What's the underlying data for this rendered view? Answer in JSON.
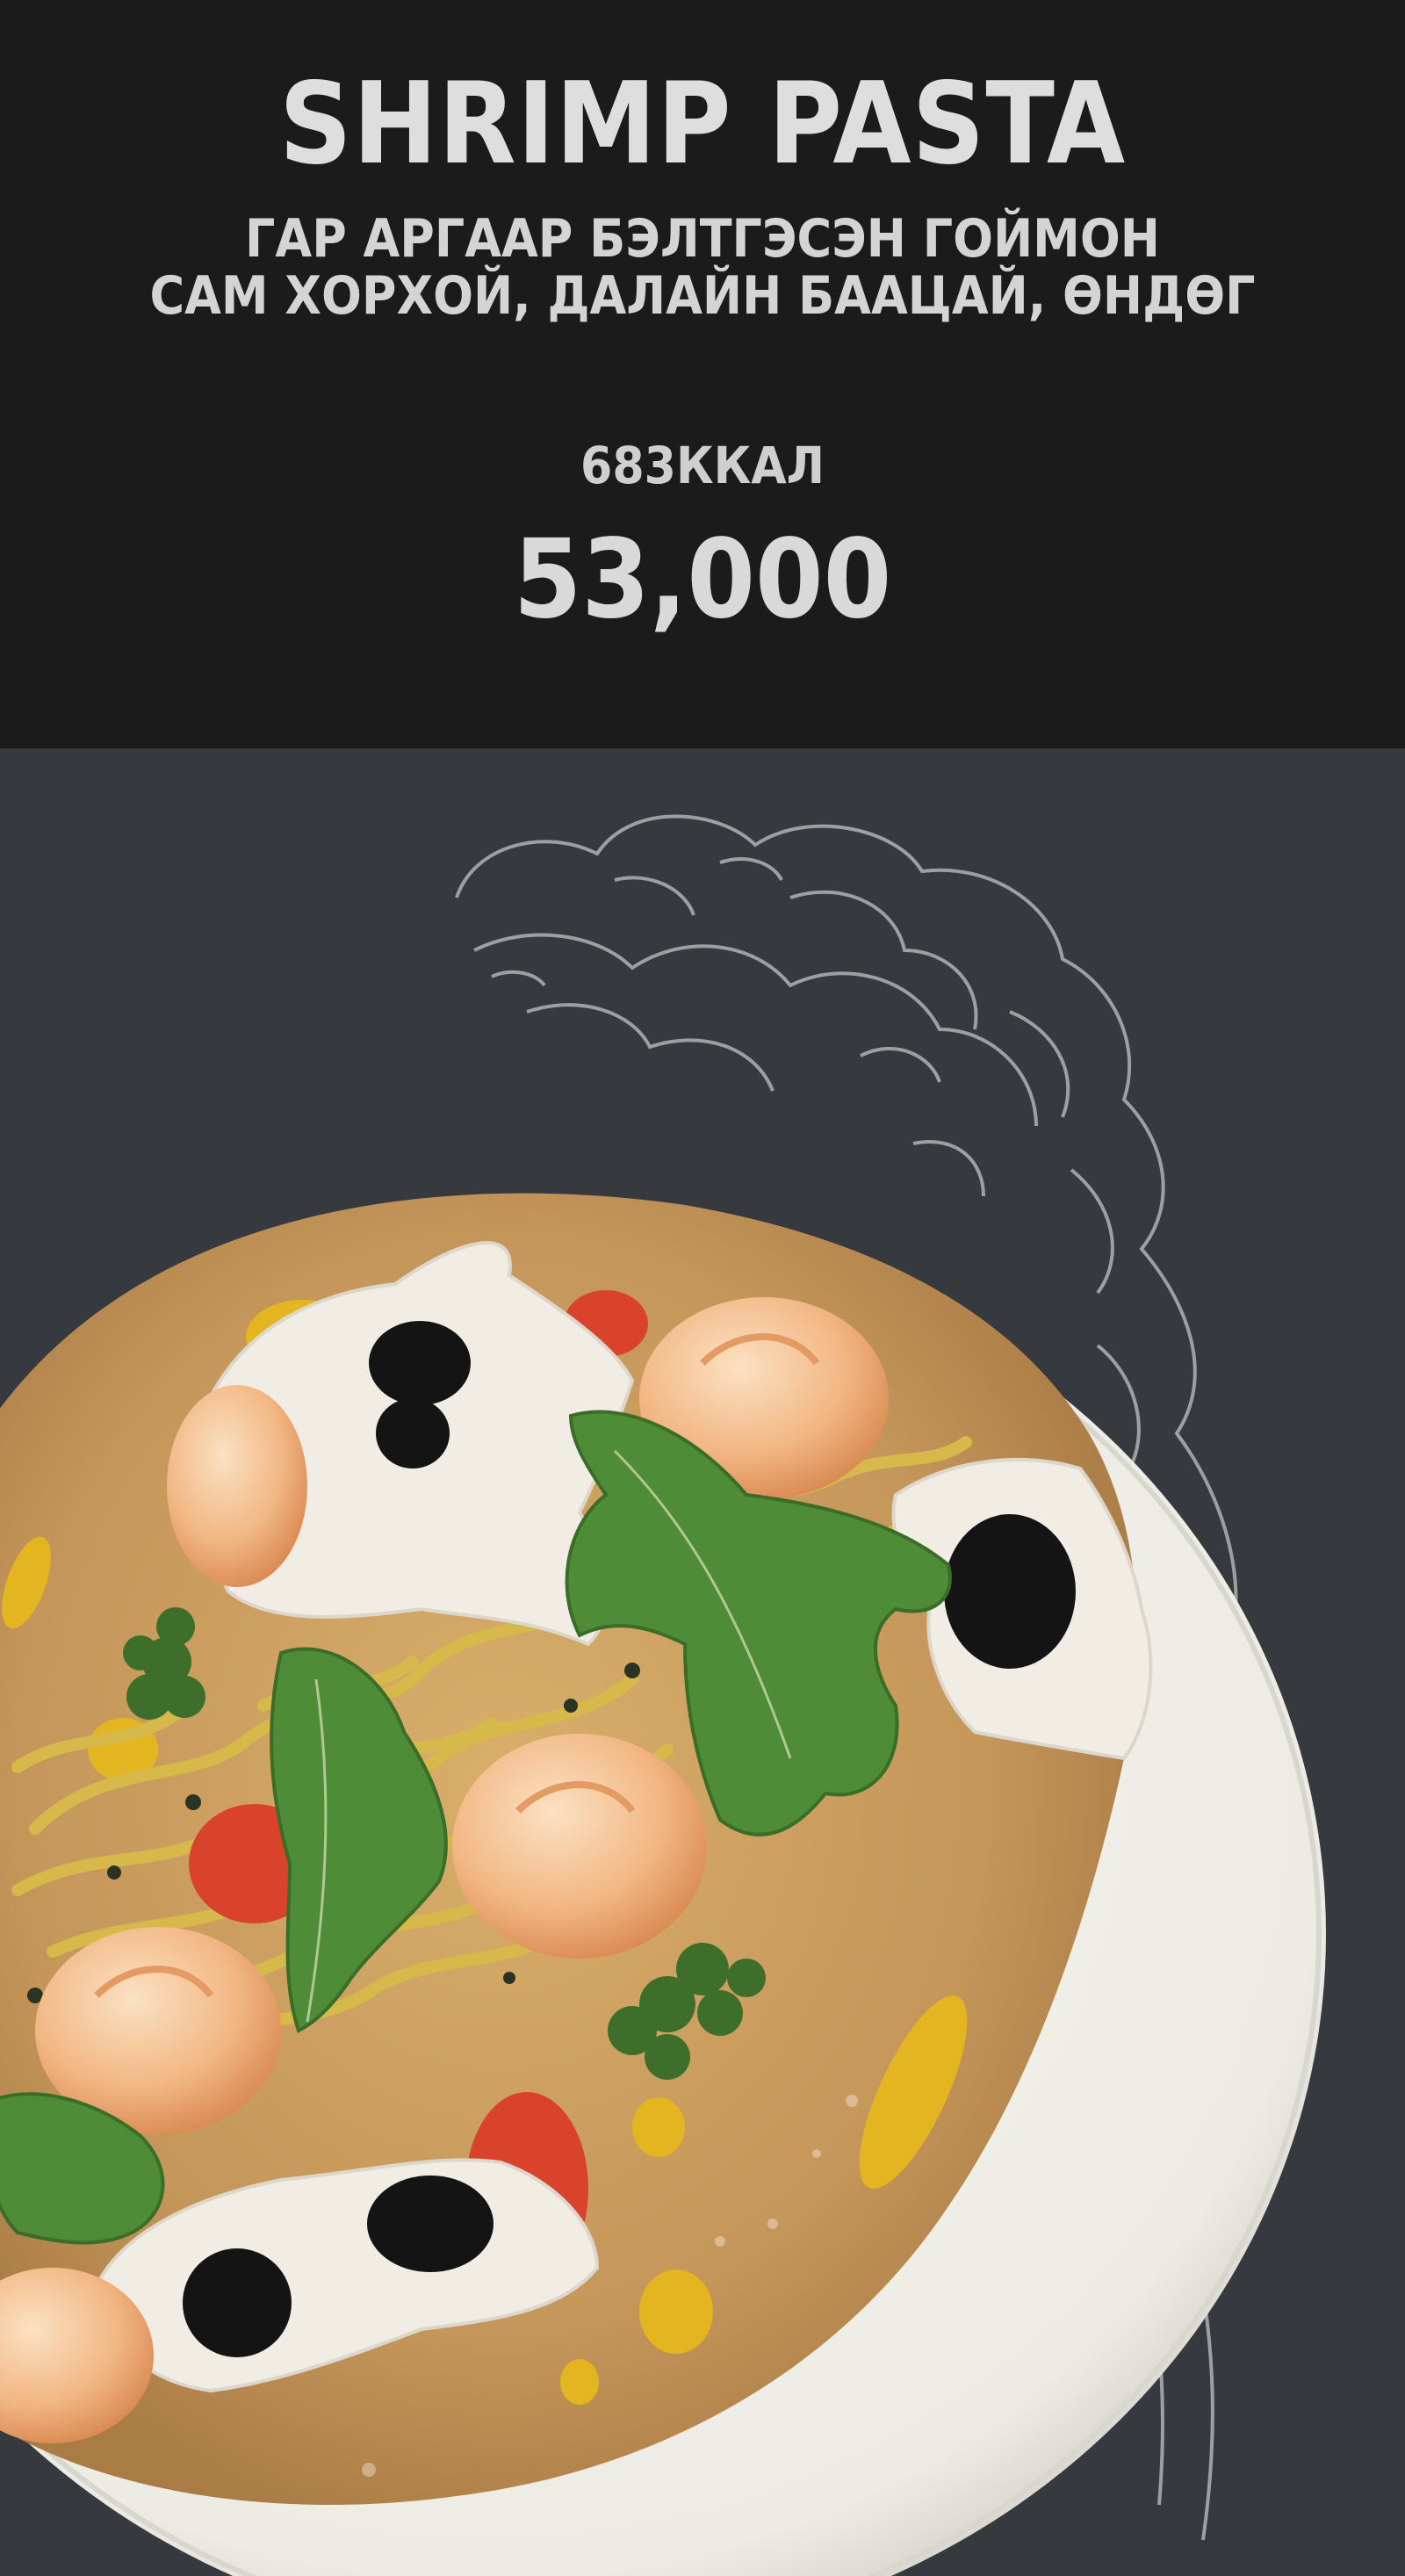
{
  "menu_item": {
    "title": "SHRIMP PASTA",
    "description_line1": "ГАР АРГААР БЭЛТГЭСЭН ГОЙМОН",
    "description_line2": "САМ ХОРХОЙ, ДАЛАЙН БААЦАЙ, ӨНДӨГ",
    "calories": "683ККАЛ",
    "price": "53,000"
  },
  "colors": {
    "header_background": "#1b1b1c",
    "photo_background": "#363a3e",
    "text": "#dedede",
    "plate": "#f3f1ea",
    "sauce": "#c99a5a"
  },
  "photo": {
    "icons": [
      "plate-icon",
      "shrimp-icon",
      "caviar-icon",
      "arugula-icon",
      "parsley-icon",
      "tomato-icon",
      "pasta-icon",
      "rice-cracker-icon",
      "line-art-sculpture-icon"
    ]
  }
}
